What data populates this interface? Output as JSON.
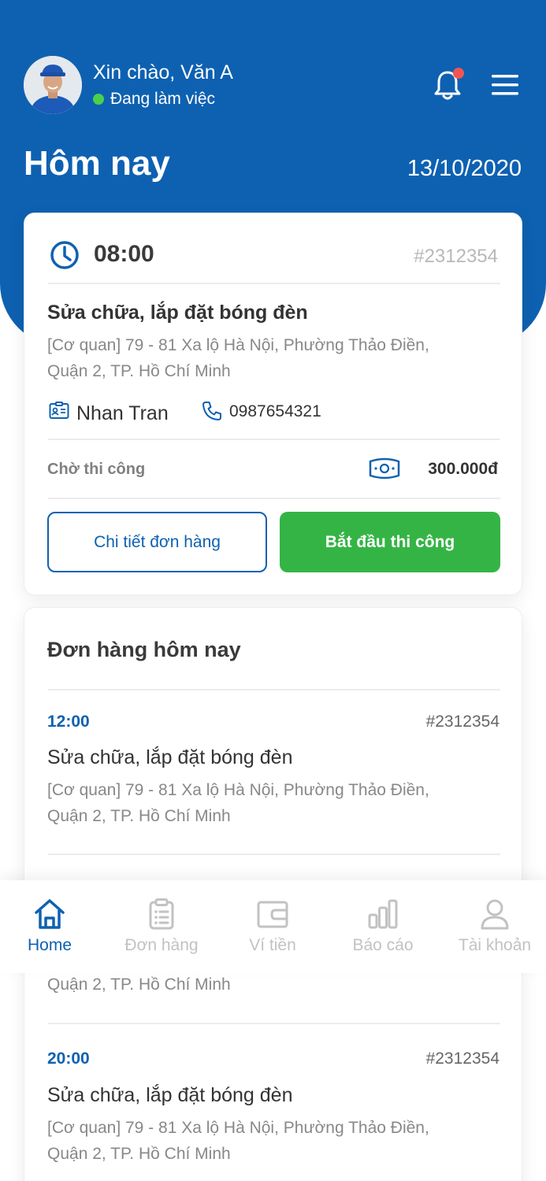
{
  "header": {
    "greeting": "Xin chào, Văn A",
    "status": "Đang làm việc",
    "title": "Hôm nay",
    "date": "13/10/2020",
    "icons": [
      "bell-icon",
      "menu-icon"
    ],
    "has_notification": true
  },
  "current_order": {
    "time": "08:00",
    "code": "#2312354",
    "title": "Sửa chữa, lắp đặt bóng đèn",
    "address_line1": "[Cơ quan] 79 - 81 Xa lộ Hà Nội, Phường Thảo Điền,",
    "address_line2": "Quận 2, TP. Hồ Chí Minh",
    "customer_name": "Nhan Tran",
    "phone": "0987654321",
    "status": "Chờ thi công",
    "price": "300.000đ",
    "detail_button": "Chi tiết đơn hàng",
    "start_button": "Bắt đầu thi công"
  },
  "today_orders": {
    "title": "Đơn hàng hôm nay",
    "items": [
      {
        "time": "12:00",
        "code": "#2312354",
        "title": "Sửa chữa, lắp đặt bóng đèn",
        "address_line1": "[Cơ quan] 79 - 81 Xa lộ Hà Nội, Phường Thảo Điền,",
        "address_line2": "Quận 2, TP. Hồ Chí Minh"
      },
      {
        "address_line2": "Quận 2, TP. Hồ Chí Minh"
      },
      {
        "time": "20:00",
        "code": "#2312354",
        "title": "Sửa chữa, lắp đặt bóng đèn",
        "address_line1": "[Cơ quan] 79 - 81 Xa lộ Hà Nội, Phường Thảo Điền,",
        "address_line2": "Quận 2, TP. Hồ Chí Minh"
      }
    ]
  },
  "tabbar": {
    "items": [
      {
        "label": "Home",
        "icon": "home-icon",
        "active": true
      },
      {
        "label": "Đơn hàng",
        "icon": "clipboard-icon",
        "active": false
      },
      {
        "label": "Ví tiền",
        "icon": "wallet-icon",
        "active": false
      },
      {
        "label": "Báo cáo",
        "icon": "chart-icon",
        "active": false
      },
      {
        "label": "Tài khoản",
        "icon": "user-icon",
        "active": false
      }
    ]
  },
  "colors": {
    "primary": "#0e61b1",
    "success": "#35b446",
    "status_online": "#4cd04c",
    "notification": "#f05555",
    "muted": "#888888"
  }
}
